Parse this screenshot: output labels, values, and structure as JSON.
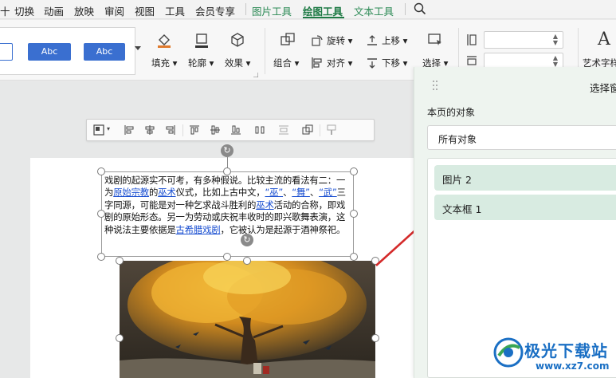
{
  "menu": {
    "items": [
      {
        "label": "十",
        "green": false
      },
      {
        "label": "切换",
        "green": false
      },
      {
        "label": "动画",
        "green": false
      },
      {
        "label": "放映",
        "green": false
      },
      {
        "label": "审阅",
        "green": false
      },
      {
        "label": "视图",
        "green": false
      },
      {
        "label": "工具",
        "green": false
      },
      {
        "label": "会员专享",
        "green": false
      },
      {
        "label": "图片工具",
        "green": true
      },
      {
        "label": "绘图工具",
        "green": true,
        "active": true
      },
      {
        "label": "文本工具",
        "green": true
      }
    ]
  },
  "ribbon": {
    "style_presets": [
      "Abc",
      "Abc"
    ],
    "fill_label": "填充",
    "outline_label": "轮廓",
    "effect_label": "效果",
    "group_label": "组合",
    "rotate_label": "旋转",
    "align_label": "对齐",
    "up_label": "上移",
    "down_label": "下移",
    "select_label": "选择",
    "art_label": "艺术字样"
  },
  "document": {
    "paragraph": [
      {
        "t": "戏剧的起源实不可考，有多种假说。比较主流的看法有二：一为"
      },
      {
        "t": "原始宗教",
        "link": true
      },
      {
        "t": "的"
      },
      {
        "t": "巫术",
        "link": true
      },
      {
        "t": "仪式，比如上古中文，"
      },
      {
        "t": "“巫”",
        "link": true
      },
      {
        "t": "、"
      },
      {
        "t": "“舞”",
        "link": true
      },
      {
        "t": "、"
      },
      {
        "t": "“武”",
        "link": true
      },
      {
        "t": "三字同源，可能是对一种乞求战斗胜利的"
      },
      {
        "t": "巫术",
        "link": true
      },
      {
        "t": "活动的合称，即戏剧的原始形态。另一为劳动或庆祝丰收时的即兴歌舞表演，这种说法主要依据是"
      },
      {
        "t": "古希腊戏剧",
        "link": true
      },
      {
        "t": "，它被认为是起源于酒神祭祀。"
      }
    ]
  },
  "panel": {
    "title": "选择窗",
    "subtitle": "本页的对象",
    "filter_value": "所有对象",
    "objects": [
      "图片 2",
      "文本框 1"
    ]
  },
  "watermark": {
    "title": "极光下载站",
    "url": "www.xz7.com"
  },
  "colors": {
    "accent": "#1e7a45",
    "style_blue": "#3a6fd0",
    "selected_item": "#d8ebe1",
    "arrow": "#d42a2a",
    "link": "#1a4fd1"
  }
}
